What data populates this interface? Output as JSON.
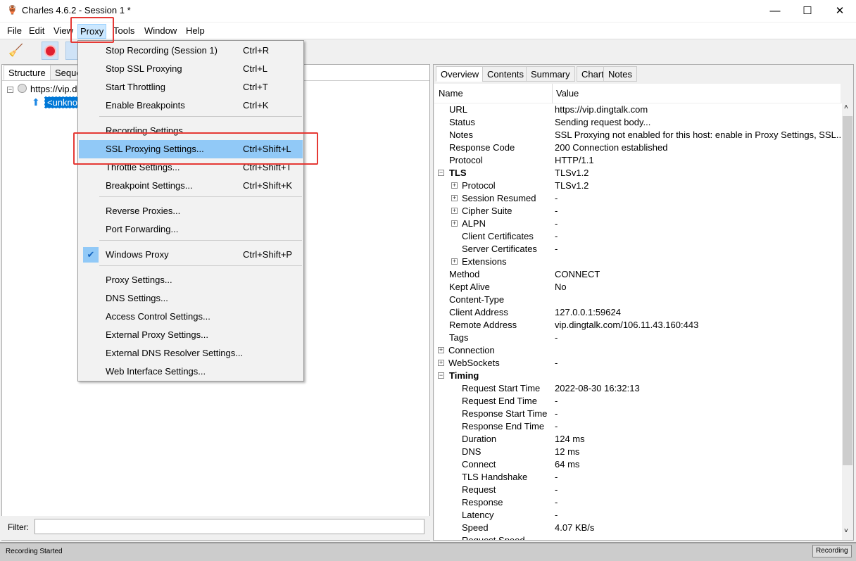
{
  "window": {
    "title": "Charles 4.6.2 - Session 1 *",
    "minimize": "—",
    "maximize": "☐",
    "close": "✕"
  },
  "menubar": [
    "File",
    "Edit",
    "View",
    "Proxy",
    "Tools",
    "Window",
    "Help"
  ],
  "left": {
    "tabs": [
      "Structure",
      "Sequence"
    ],
    "tree": {
      "host": "https://vip.dingtalk.com",
      "child": "<unknown>"
    },
    "filter_label": "Filter:",
    "filter_value": ""
  },
  "menu": {
    "items": [
      {
        "label": "Stop Recording (Session 1)",
        "shortcut": "Ctrl+R"
      },
      {
        "label": "Stop SSL Proxying",
        "shortcut": "Ctrl+L"
      },
      {
        "label": "Start Throttling",
        "shortcut": "Ctrl+T"
      },
      {
        "label": "Enable Breakpoints",
        "shortcut": "Ctrl+K"
      },
      {
        "label": "Recording Settings...",
        "shortcut": ""
      },
      {
        "label": "SSL Proxying Settings...",
        "shortcut": "Ctrl+Shift+L",
        "highlighted": true
      },
      {
        "label": "Throttle Settings...",
        "shortcut": "Ctrl+Shift+T"
      },
      {
        "label": "Breakpoint Settings...",
        "shortcut": "Ctrl+Shift+K"
      },
      {
        "label": "Reverse Proxies...",
        "shortcut": ""
      },
      {
        "label": "Port Forwarding...",
        "shortcut": ""
      },
      {
        "label": "Windows Proxy",
        "shortcut": "Ctrl+Shift+P",
        "checked": true
      },
      {
        "label": "Proxy Settings...",
        "shortcut": ""
      },
      {
        "label": "DNS Settings...",
        "shortcut": ""
      },
      {
        "label": "Access Control Settings...",
        "shortcut": ""
      },
      {
        "label": "External Proxy Settings...",
        "shortcut": ""
      },
      {
        "label": "External DNS Resolver Settings...",
        "shortcut": ""
      },
      {
        "label": "Web Interface Settings...",
        "shortcut": ""
      }
    ]
  },
  "right": {
    "tabs": [
      "Overview",
      "Contents",
      "Summary",
      "Chart",
      "Notes"
    ],
    "columns": [
      "Name",
      "Value"
    ],
    "rows": [
      {
        "name": "URL",
        "value": "https://vip.dingtalk.com",
        "level": 0
      },
      {
        "name": "Status",
        "value": "Sending request body...",
        "level": 0
      },
      {
        "name": "Notes",
        "value": "SSL Proxying not enabled for this host: enable in Proxy Settings, SSL...",
        "level": 0
      },
      {
        "name": "Response Code",
        "value": "200 Connection established",
        "level": 0
      },
      {
        "name": "Protocol",
        "value": "HTTP/1.1",
        "level": 0
      },
      {
        "name": "TLS",
        "value": "TLSv1.2",
        "level": 0,
        "expander": "minus",
        "bold": true
      },
      {
        "name": "Protocol",
        "value": "TLSv1.2",
        "level": 1,
        "expander": "plus"
      },
      {
        "name": "Session Resumed",
        "value": "-",
        "level": 1,
        "expander": "plus"
      },
      {
        "name": "Cipher Suite",
        "value": "-",
        "level": 1,
        "expander": "plus"
      },
      {
        "name": "ALPN",
        "value": "-",
        "level": 1,
        "expander": "plus"
      },
      {
        "name": "Client Certificates",
        "value": "-",
        "level": 1
      },
      {
        "name": "Server Certificates",
        "value": "-",
        "level": 1
      },
      {
        "name": "Extensions",
        "value": "",
        "level": 1,
        "expander": "plus"
      },
      {
        "name": "Method",
        "value": "CONNECT",
        "level": 0
      },
      {
        "name": "Kept Alive",
        "value": "No",
        "level": 0
      },
      {
        "name": "Content-Type",
        "value": "",
        "level": 0
      },
      {
        "name": "Client Address",
        "value": "127.0.0.1:59624",
        "level": 0
      },
      {
        "name": "Remote Address",
        "value": "vip.dingtalk.com/106.11.43.160:443",
        "level": 0
      },
      {
        "name": "Tags",
        "value": "-",
        "level": 0
      },
      {
        "name": "Connection",
        "value": "",
        "level": 0,
        "expander": "plus",
        "outer": true
      },
      {
        "name": "WebSockets",
        "value": "-",
        "level": 0,
        "expander": "plus",
        "outer": true
      },
      {
        "name": "Timing",
        "value": "",
        "level": 0,
        "expander": "minus",
        "bold": true
      },
      {
        "name": "Request Start Time",
        "value": "2022-08-30 16:32:13",
        "level": 1
      },
      {
        "name": "Request End Time",
        "value": "-",
        "level": 1
      },
      {
        "name": "Response Start Time",
        "value": "-",
        "level": 1
      },
      {
        "name": "Response End Time",
        "value": "-",
        "level": 1
      },
      {
        "name": "Duration",
        "value": "124 ms",
        "level": 1
      },
      {
        "name": "DNS",
        "value": "12 ms",
        "level": 1
      },
      {
        "name": "Connect",
        "value": "64 ms",
        "level": 1
      },
      {
        "name": "TLS Handshake",
        "value": "-",
        "level": 1
      },
      {
        "name": "Request",
        "value": "-",
        "level": 1
      },
      {
        "name": "Response",
        "value": "-",
        "level": 1
      },
      {
        "name": "Latency",
        "value": "-",
        "level": 1
      },
      {
        "name": "Speed",
        "value": "4.07 KB/s",
        "level": 1
      },
      {
        "name": "Request Speed",
        "value": "",
        "level": 1
      }
    ]
  },
  "status": {
    "text": "Recording Started",
    "button": "Recording"
  },
  "colors": {
    "highlight": "#91c9f7",
    "selection": "#0078d7",
    "annotation": "#e53935"
  }
}
